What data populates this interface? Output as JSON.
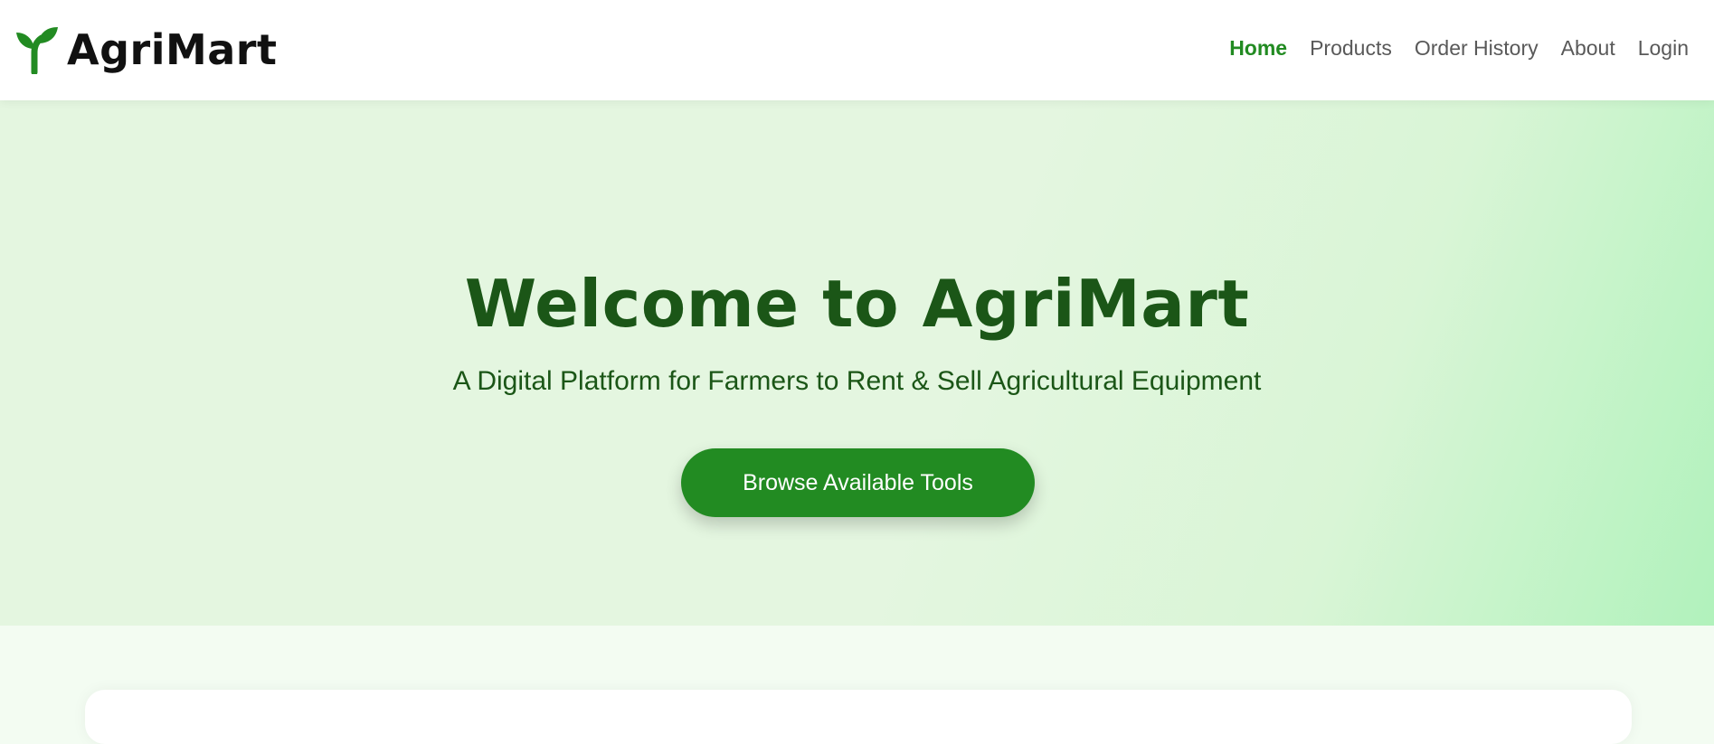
{
  "app": {
    "brand_name": "AgriMart",
    "brand_icon": "sprout-icon"
  },
  "nav": {
    "items": [
      {
        "label": "Home",
        "active": true
      },
      {
        "label": "Products",
        "active": false
      },
      {
        "label": "Order History",
        "active": false
      },
      {
        "label": "About",
        "active": false
      },
      {
        "label": "Login",
        "active": false
      }
    ]
  },
  "hero": {
    "title": "Welcome to AgriMart",
    "subtitle": "A Digital Platform for Farmers to Rent & Sell Agricultural Equipment",
    "cta_label": "Browse Available Tools"
  },
  "colors": {
    "brand_green": "#228b22",
    "hero_text": "#1b5617",
    "nav_text": "#595959",
    "hero_bg": "#e4f6e0"
  }
}
